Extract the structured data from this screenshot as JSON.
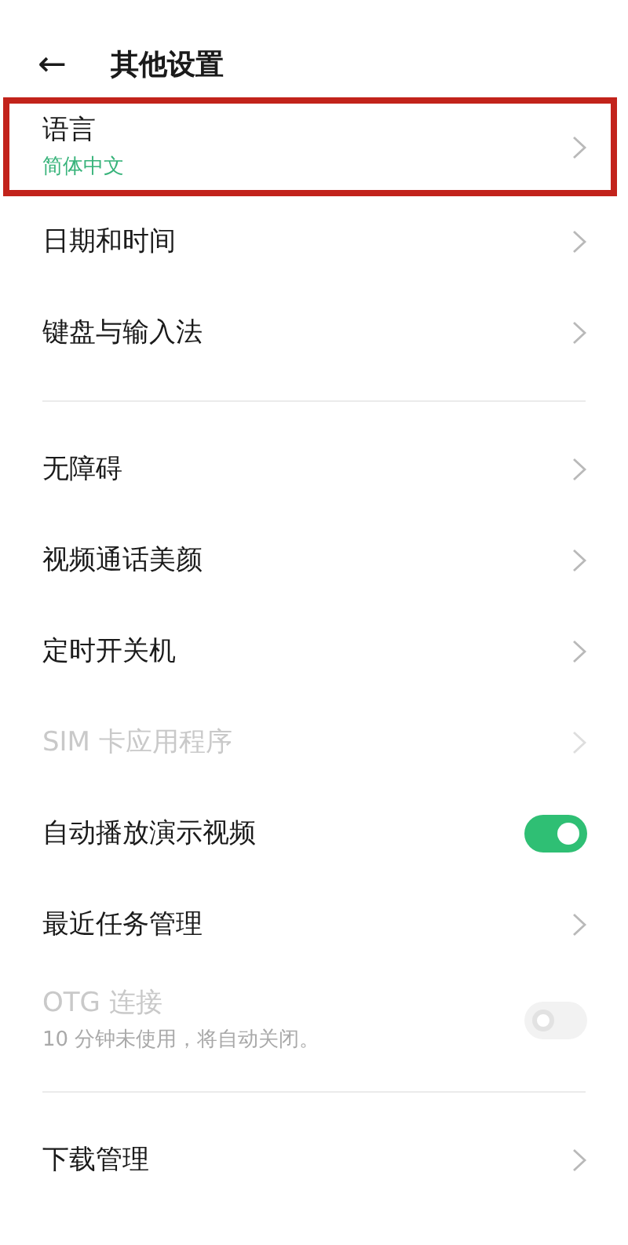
{
  "header": {
    "back_icon": "←",
    "title": "其他设置"
  },
  "sections": [
    {
      "items": [
        {
          "kind": "link",
          "label": "语言",
          "subtitle": "简体中文",
          "disabled": false,
          "highlighted": true
        },
        {
          "kind": "link",
          "label": "日期和时间",
          "disabled": false,
          "highlighted": false
        },
        {
          "kind": "link",
          "label": "键盘与输入法",
          "disabled": false,
          "highlighted": false
        }
      ]
    },
    {
      "items": [
        {
          "kind": "link",
          "label": "无障碍",
          "disabled": false,
          "highlighted": false
        },
        {
          "kind": "link",
          "label": "视频通话美颜",
          "disabled": false,
          "highlighted": false
        },
        {
          "kind": "link",
          "label": "定时开关机",
          "disabled": false,
          "highlighted": false
        },
        {
          "kind": "link",
          "label": "SIM 卡应用程序",
          "disabled": true,
          "highlighted": false
        },
        {
          "kind": "switch",
          "label": "自动播放演示视频",
          "on": true,
          "disabled": false,
          "highlighted": false
        },
        {
          "kind": "link",
          "label": "最近任务管理",
          "disabled": false,
          "highlighted": false
        },
        {
          "kind": "switch",
          "label": "OTG 连接",
          "subtitle": "10 分钟未使用，将自动关闭。",
          "on": false,
          "disabled": true,
          "highlighted": false
        }
      ]
    },
    {
      "items": [
        {
          "kind": "link",
          "label": "下载管理",
          "disabled": false,
          "highlighted": false
        }
      ]
    }
  ]
}
